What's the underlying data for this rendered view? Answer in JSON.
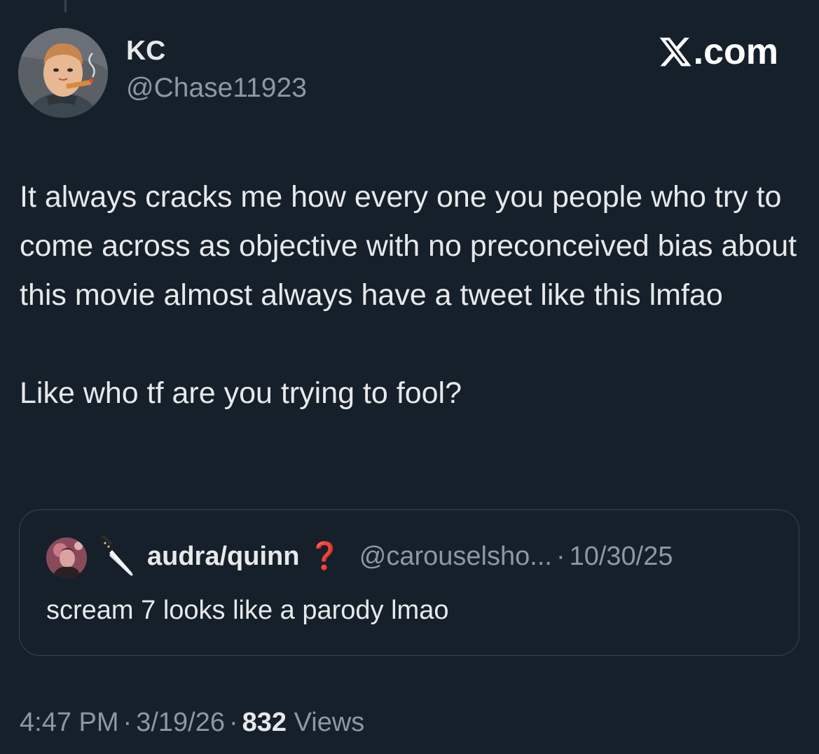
{
  "author": {
    "display_name": "KC",
    "handle": "@Chase11923",
    "avatar_icon": "cartoon-man-smoking-avatar"
  },
  "brand": {
    "text": ".com",
    "logo_icon": "x-logo-icon"
  },
  "tweet": {
    "paragraphs": [
      "It always cracks me how every one you people who try to come across as objective with no preconceived bias about this movie almost always have a tweet like this lmfao",
      "Like who tf are you trying to fool?"
    ]
  },
  "quote": {
    "avatar_icon": "profile-photo-avatar",
    "name_prefix_icon": "knife-emoji-icon",
    "name": "audra/quinn",
    "name_suffix": "❓",
    "handle": "@carouselsho...",
    "separator": "·",
    "date": "10/30/25",
    "text": "scream 7 looks like a parody lmao"
  },
  "meta": {
    "time": "4:47 PM",
    "separator": "·",
    "date": "3/19/26",
    "views_count": "832",
    "views_label": "Views"
  },
  "colors": {
    "background": "#15202b",
    "primary_text": "#e7e9ea",
    "secondary_text": "#8b98a5",
    "border": "#38444d",
    "emoji_red": "#e0262e"
  }
}
